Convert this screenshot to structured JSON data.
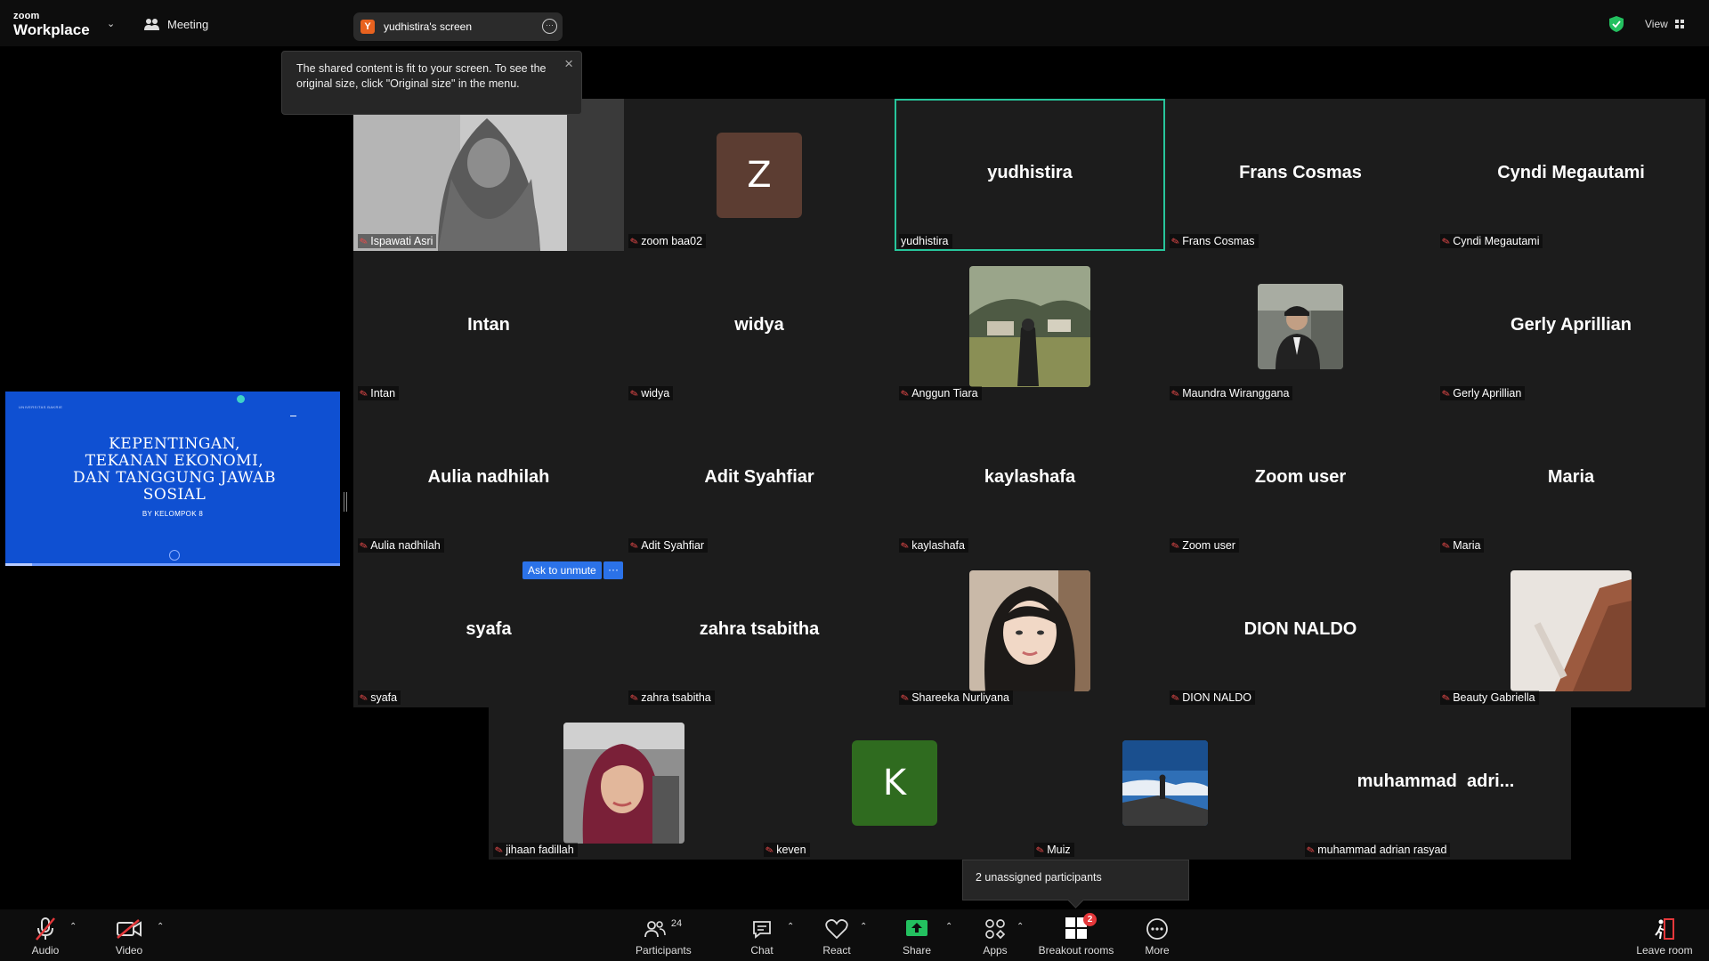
{
  "app": {
    "brand_line1": "zoom",
    "brand_line2": "Workplace"
  },
  "topbar": {
    "meeting_label": "Meeting",
    "share_initial": "Y",
    "share_title": "yudhistira's screen",
    "view_label": "View"
  },
  "tooltip": {
    "text": "The shared content is fit to your screen. To see the original size, click \"Original size\" in the menu."
  },
  "shared_slide": {
    "institution": "UNIVERSITAS BAKRIE",
    "title_lines": [
      "KEPENTINGAN,",
      "TEKANAN EKONOMI,",
      "DAN TANGGUNG JAWAB",
      "SOSIAL"
    ],
    "subtitle": "BY KELOMPOK 8"
  },
  "participants": [
    {
      "display": "",
      "label": "Ispawati Asri",
      "kind": "photo",
      "muted": true
    },
    {
      "display": "Z",
      "label": "zoom baa02",
      "kind": "letter",
      "avatar_color": "#5c3d32",
      "muted": true
    },
    {
      "display": "yudhistira",
      "label": "yudhistira",
      "kind": "name",
      "active": true,
      "muted": false
    },
    {
      "display": "Frans Cosmas",
      "label": "Frans Cosmas",
      "kind": "name",
      "muted": true
    },
    {
      "display": "Cyndi Megautami",
      "label": "Cyndi Megautami",
      "kind": "name",
      "muted": true
    },
    {
      "display": "Intan",
      "label": "Intan",
      "kind": "name",
      "muted": true
    },
    {
      "display": "widya",
      "label": "widya",
      "kind": "name",
      "muted": true
    },
    {
      "display": "",
      "label": "Anggun Tiara",
      "kind": "photo",
      "muted": true
    },
    {
      "display": "",
      "label": "Maundra Wiranggana",
      "kind": "photo",
      "muted": true
    },
    {
      "display": "Gerly Aprillian",
      "label": "Gerly Aprillian",
      "kind": "name",
      "muted": true
    },
    {
      "display": "Aulia nadhilah",
      "label": "Aulia nadhilah",
      "kind": "name",
      "muted": true
    },
    {
      "display": "Adit Syahfiar",
      "label": "Adit Syahfiar",
      "kind": "name",
      "muted": true
    },
    {
      "display": "kaylashafa",
      "label": "kaylashafa",
      "kind": "name",
      "muted": true
    },
    {
      "display": "Zoom user",
      "label": "Zoom user",
      "kind": "name",
      "muted": true
    },
    {
      "display": "Maria",
      "label": "Maria",
      "kind": "name",
      "muted": true
    },
    {
      "display": "syafa",
      "label": "syafa",
      "kind": "name",
      "muted": true
    },
    {
      "display": "zahra tsabitha",
      "label": "zahra tsabitha",
      "kind": "name",
      "muted": true
    },
    {
      "display": "",
      "label": "Shareeka Nurliyana",
      "kind": "photo",
      "muted": true
    },
    {
      "display": "DION NALDO",
      "label": "DION NALDO",
      "kind": "name",
      "muted": true
    },
    {
      "display": "",
      "label": "Beauty Gabriella",
      "kind": "photo",
      "muted": true
    },
    {
      "display": "",
      "label": "jihaan fadillah",
      "kind": "photo",
      "muted": true
    },
    {
      "display": "K",
      "label": "keven",
      "kind": "letter",
      "avatar_color": "#2f6b1f",
      "muted": true
    },
    {
      "display": "",
      "label": "Muiz",
      "kind": "photo",
      "muted": true
    },
    {
      "display": "muhammad  adri...",
      "label": "muhammad adrian rasyad",
      "kind": "name",
      "muted": true
    }
  ],
  "ask_unmute": {
    "label": "Ask to unmute",
    "more": "···"
  },
  "unassigned": {
    "text": "2 unassigned participants"
  },
  "toolbar": {
    "audio": "Audio",
    "video": "Video",
    "participants": "Participants",
    "participants_count": "24",
    "chat": "Chat",
    "react": "React",
    "share": "Share",
    "apps": "Apps",
    "breakout": "Breakout rooms",
    "breakout_badge": "2",
    "more": "More",
    "leave": "Leave room"
  },
  "colors": {
    "active_border": "#27c59b",
    "share_green": "#23c05f",
    "slide_blue": "#0f50d2",
    "mute_red": "#e74a4a"
  }
}
